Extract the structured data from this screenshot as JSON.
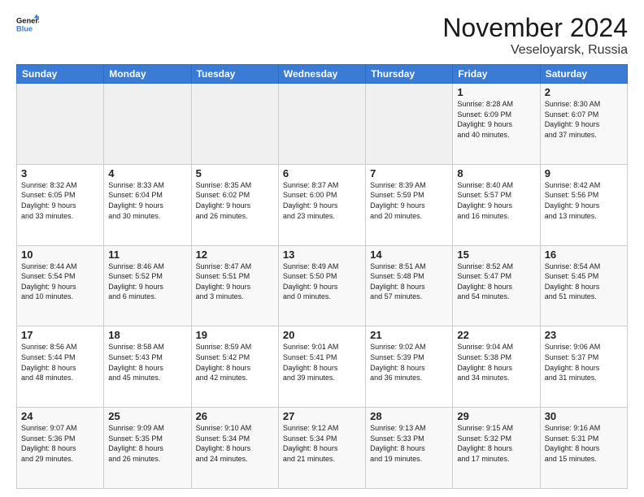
{
  "logo": {
    "line1": "General",
    "line2": "Blue"
  },
  "title": "November 2024",
  "location": "Veseloyarsk, Russia",
  "days_header": [
    "Sunday",
    "Monday",
    "Tuesday",
    "Wednesday",
    "Thursday",
    "Friday",
    "Saturday"
  ],
  "weeks": [
    [
      {
        "day": "",
        "info": ""
      },
      {
        "day": "",
        "info": ""
      },
      {
        "day": "",
        "info": ""
      },
      {
        "day": "",
        "info": ""
      },
      {
        "day": "",
        "info": ""
      },
      {
        "day": "1",
        "info": "Sunrise: 8:28 AM\nSunset: 6:09 PM\nDaylight: 9 hours\nand 40 minutes."
      },
      {
        "day": "2",
        "info": "Sunrise: 8:30 AM\nSunset: 6:07 PM\nDaylight: 9 hours\nand 37 minutes."
      }
    ],
    [
      {
        "day": "3",
        "info": "Sunrise: 8:32 AM\nSunset: 6:05 PM\nDaylight: 9 hours\nand 33 minutes."
      },
      {
        "day": "4",
        "info": "Sunrise: 8:33 AM\nSunset: 6:04 PM\nDaylight: 9 hours\nand 30 minutes."
      },
      {
        "day": "5",
        "info": "Sunrise: 8:35 AM\nSunset: 6:02 PM\nDaylight: 9 hours\nand 26 minutes."
      },
      {
        "day": "6",
        "info": "Sunrise: 8:37 AM\nSunset: 6:00 PM\nDaylight: 9 hours\nand 23 minutes."
      },
      {
        "day": "7",
        "info": "Sunrise: 8:39 AM\nSunset: 5:59 PM\nDaylight: 9 hours\nand 20 minutes."
      },
      {
        "day": "8",
        "info": "Sunrise: 8:40 AM\nSunset: 5:57 PM\nDaylight: 9 hours\nand 16 minutes."
      },
      {
        "day": "9",
        "info": "Sunrise: 8:42 AM\nSunset: 5:56 PM\nDaylight: 9 hours\nand 13 minutes."
      }
    ],
    [
      {
        "day": "10",
        "info": "Sunrise: 8:44 AM\nSunset: 5:54 PM\nDaylight: 9 hours\nand 10 minutes."
      },
      {
        "day": "11",
        "info": "Sunrise: 8:46 AM\nSunset: 5:52 PM\nDaylight: 9 hours\nand 6 minutes."
      },
      {
        "day": "12",
        "info": "Sunrise: 8:47 AM\nSunset: 5:51 PM\nDaylight: 9 hours\nand 3 minutes."
      },
      {
        "day": "13",
        "info": "Sunrise: 8:49 AM\nSunset: 5:50 PM\nDaylight: 9 hours\nand 0 minutes."
      },
      {
        "day": "14",
        "info": "Sunrise: 8:51 AM\nSunset: 5:48 PM\nDaylight: 8 hours\nand 57 minutes."
      },
      {
        "day": "15",
        "info": "Sunrise: 8:52 AM\nSunset: 5:47 PM\nDaylight: 8 hours\nand 54 minutes."
      },
      {
        "day": "16",
        "info": "Sunrise: 8:54 AM\nSunset: 5:45 PM\nDaylight: 8 hours\nand 51 minutes."
      }
    ],
    [
      {
        "day": "17",
        "info": "Sunrise: 8:56 AM\nSunset: 5:44 PM\nDaylight: 8 hours\nand 48 minutes."
      },
      {
        "day": "18",
        "info": "Sunrise: 8:58 AM\nSunset: 5:43 PM\nDaylight: 8 hours\nand 45 minutes."
      },
      {
        "day": "19",
        "info": "Sunrise: 8:59 AM\nSunset: 5:42 PM\nDaylight: 8 hours\nand 42 minutes."
      },
      {
        "day": "20",
        "info": "Sunrise: 9:01 AM\nSunset: 5:41 PM\nDaylight: 8 hours\nand 39 minutes."
      },
      {
        "day": "21",
        "info": "Sunrise: 9:02 AM\nSunset: 5:39 PM\nDaylight: 8 hours\nand 36 minutes."
      },
      {
        "day": "22",
        "info": "Sunrise: 9:04 AM\nSunset: 5:38 PM\nDaylight: 8 hours\nand 34 minutes."
      },
      {
        "day": "23",
        "info": "Sunrise: 9:06 AM\nSunset: 5:37 PM\nDaylight: 8 hours\nand 31 minutes."
      }
    ],
    [
      {
        "day": "24",
        "info": "Sunrise: 9:07 AM\nSunset: 5:36 PM\nDaylight: 8 hours\nand 29 minutes."
      },
      {
        "day": "25",
        "info": "Sunrise: 9:09 AM\nSunset: 5:35 PM\nDaylight: 8 hours\nand 26 minutes."
      },
      {
        "day": "26",
        "info": "Sunrise: 9:10 AM\nSunset: 5:34 PM\nDaylight: 8 hours\nand 24 minutes."
      },
      {
        "day": "27",
        "info": "Sunrise: 9:12 AM\nSunset: 5:34 PM\nDaylight: 8 hours\nand 21 minutes."
      },
      {
        "day": "28",
        "info": "Sunrise: 9:13 AM\nSunset: 5:33 PM\nDaylight: 8 hours\nand 19 minutes."
      },
      {
        "day": "29",
        "info": "Sunrise: 9:15 AM\nSunset: 5:32 PM\nDaylight: 8 hours\nand 17 minutes."
      },
      {
        "day": "30",
        "info": "Sunrise: 9:16 AM\nSunset: 5:31 PM\nDaylight: 8 hours\nand 15 minutes."
      }
    ]
  ]
}
